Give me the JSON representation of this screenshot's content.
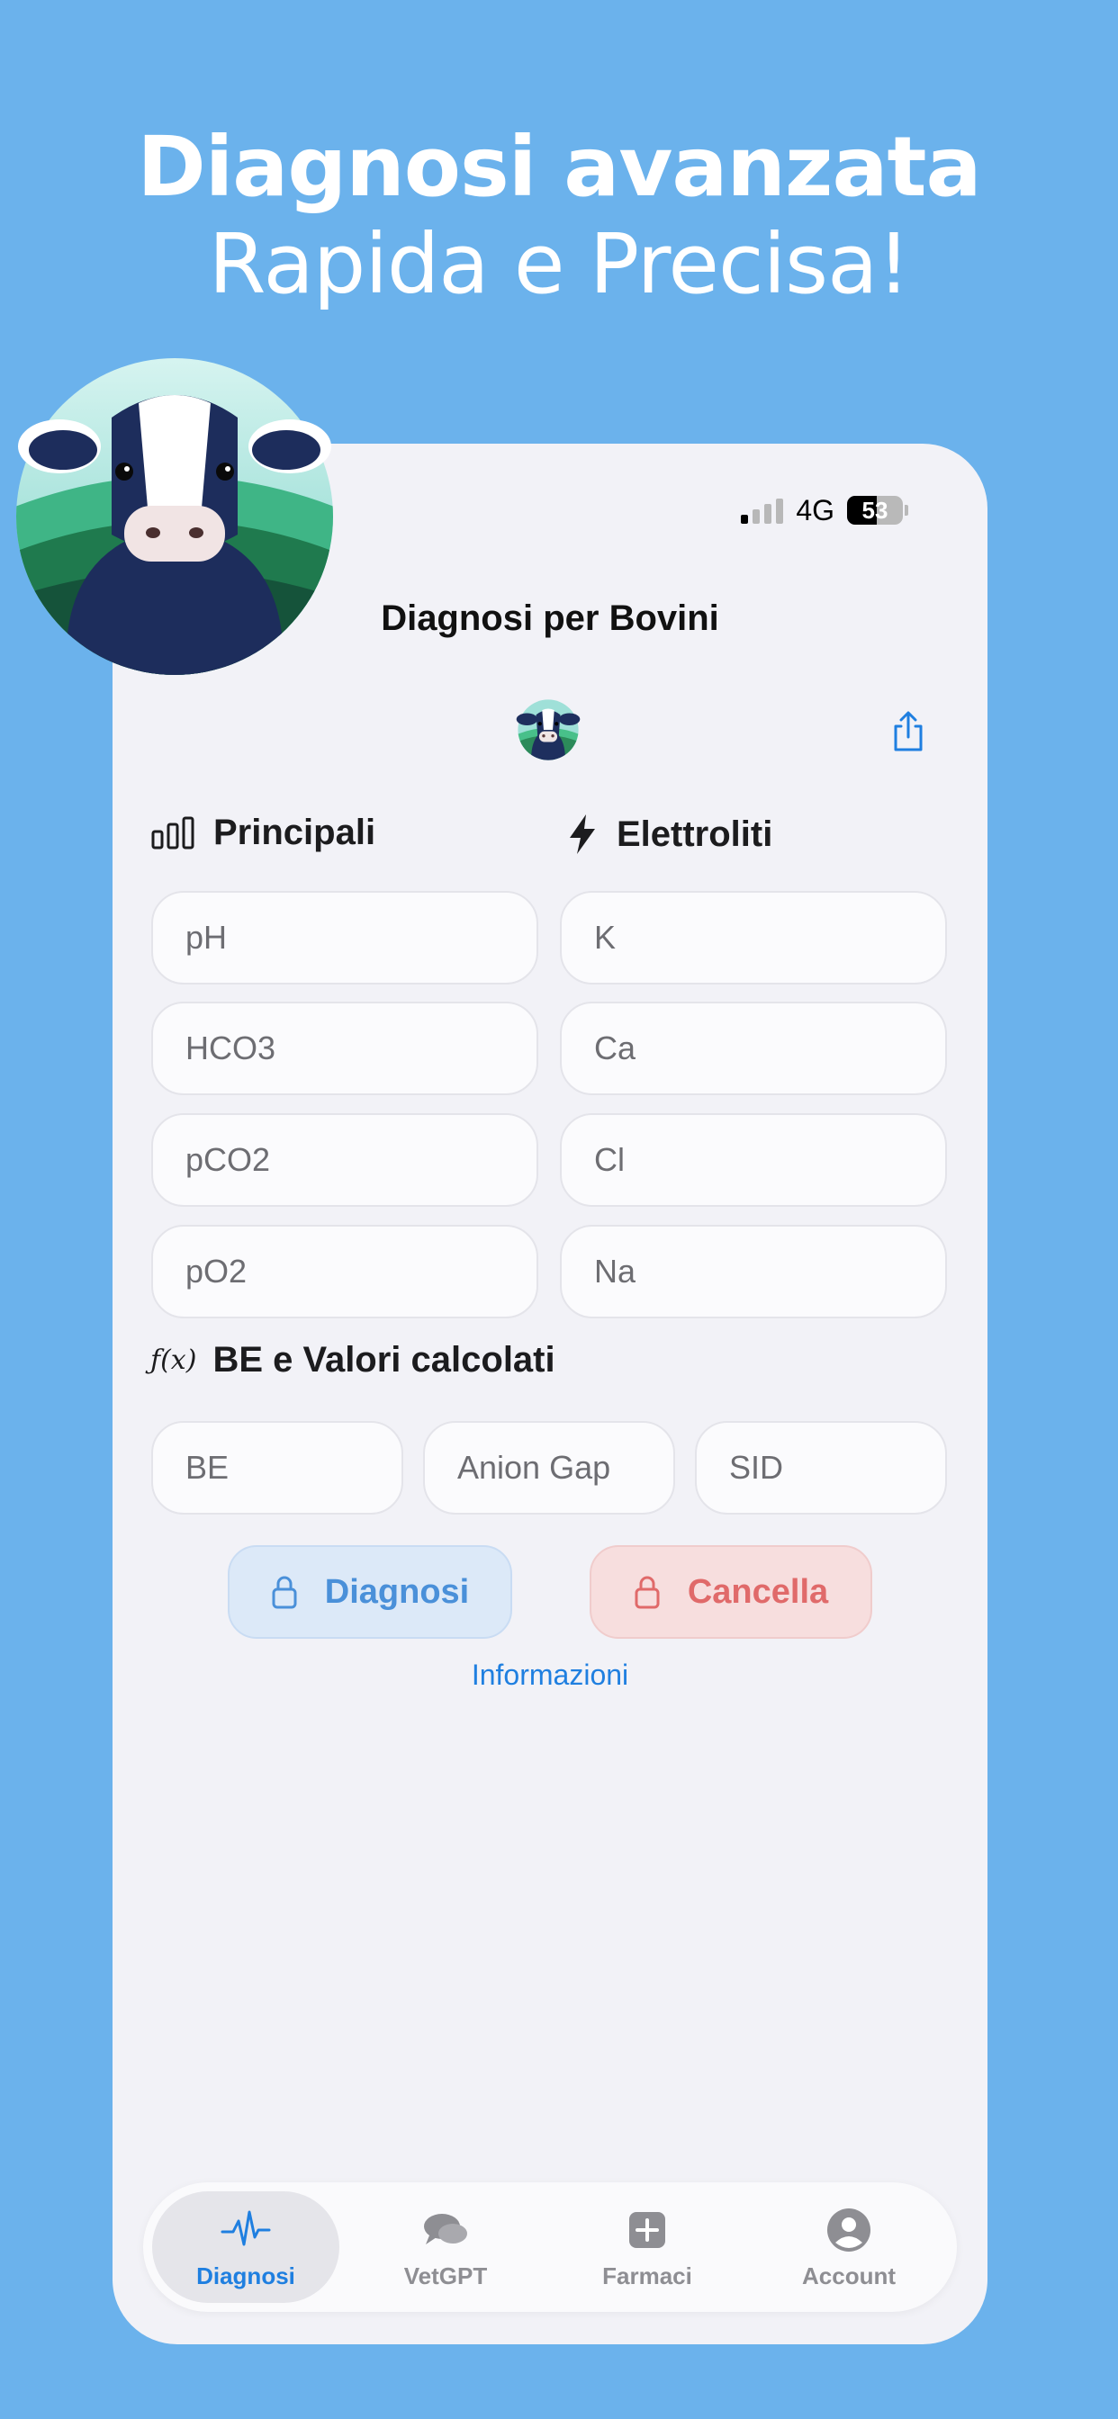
{
  "promo": {
    "headline": "Diagnosi avanzata",
    "subheadline": "Rapida e Precisa!"
  },
  "status_bar": {
    "network": "4G",
    "battery": "53",
    "battery_level": 0.53
  },
  "nav": {
    "title": "Diagnosi per Bovini",
    "share_icon": "share-icon",
    "logo_icon": "cow-logo-icon"
  },
  "sections": {
    "principali": {
      "title": "Principali",
      "icon": "chart-bars-icon"
    },
    "elettroliti": {
      "title": "Elettroliti",
      "icon": "bolt-icon"
    },
    "calcolati": {
      "title": "BE e Valori calcolati",
      "icon": "function-icon",
      "icon_text": "ƒ(x)"
    }
  },
  "fields": {
    "ph": {
      "placeholder": "pH",
      "value": ""
    },
    "hco3": {
      "placeholder": "HCO3",
      "value": ""
    },
    "pco2": {
      "placeholder": "pCO2",
      "value": ""
    },
    "po2": {
      "placeholder": "pO2",
      "value": ""
    },
    "k": {
      "placeholder": "K",
      "value": ""
    },
    "ca": {
      "placeholder": "Ca",
      "value": ""
    },
    "cl": {
      "placeholder": "Cl",
      "value": ""
    },
    "na": {
      "placeholder": "Na",
      "value": ""
    },
    "be": {
      "placeholder": "BE",
      "value": ""
    },
    "anion_gap": {
      "placeholder": "Anion Gap",
      "value": ""
    },
    "sid": {
      "placeholder": "SID",
      "value": ""
    }
  },
  "actions": {
    "diagnosi": "Diagnosi",
    "cancella": "Cancella",
    "informazioni": "Informazioni"
  },
  "tabs": [
    {
      "label": "Diagnosi",
      "icon": "waveform-icon",
      "active": true
    },
    {
      "label": "VetGPT",
      "icon": "chat-bubbles-icon",
      "active": false
    },
    {
      "label": "Farmaci",
      "icon": "plus-square-icon",
      "active": false
    },
    {
      "label": "Account",
      "icon": "person-circle-icon",
      "active": false
    }
  ],
  "colors": {
    "background": "#6bb2ec",
    "accent": "#1f7fe0",
    "danger": "#e06a6a"
  }
}
